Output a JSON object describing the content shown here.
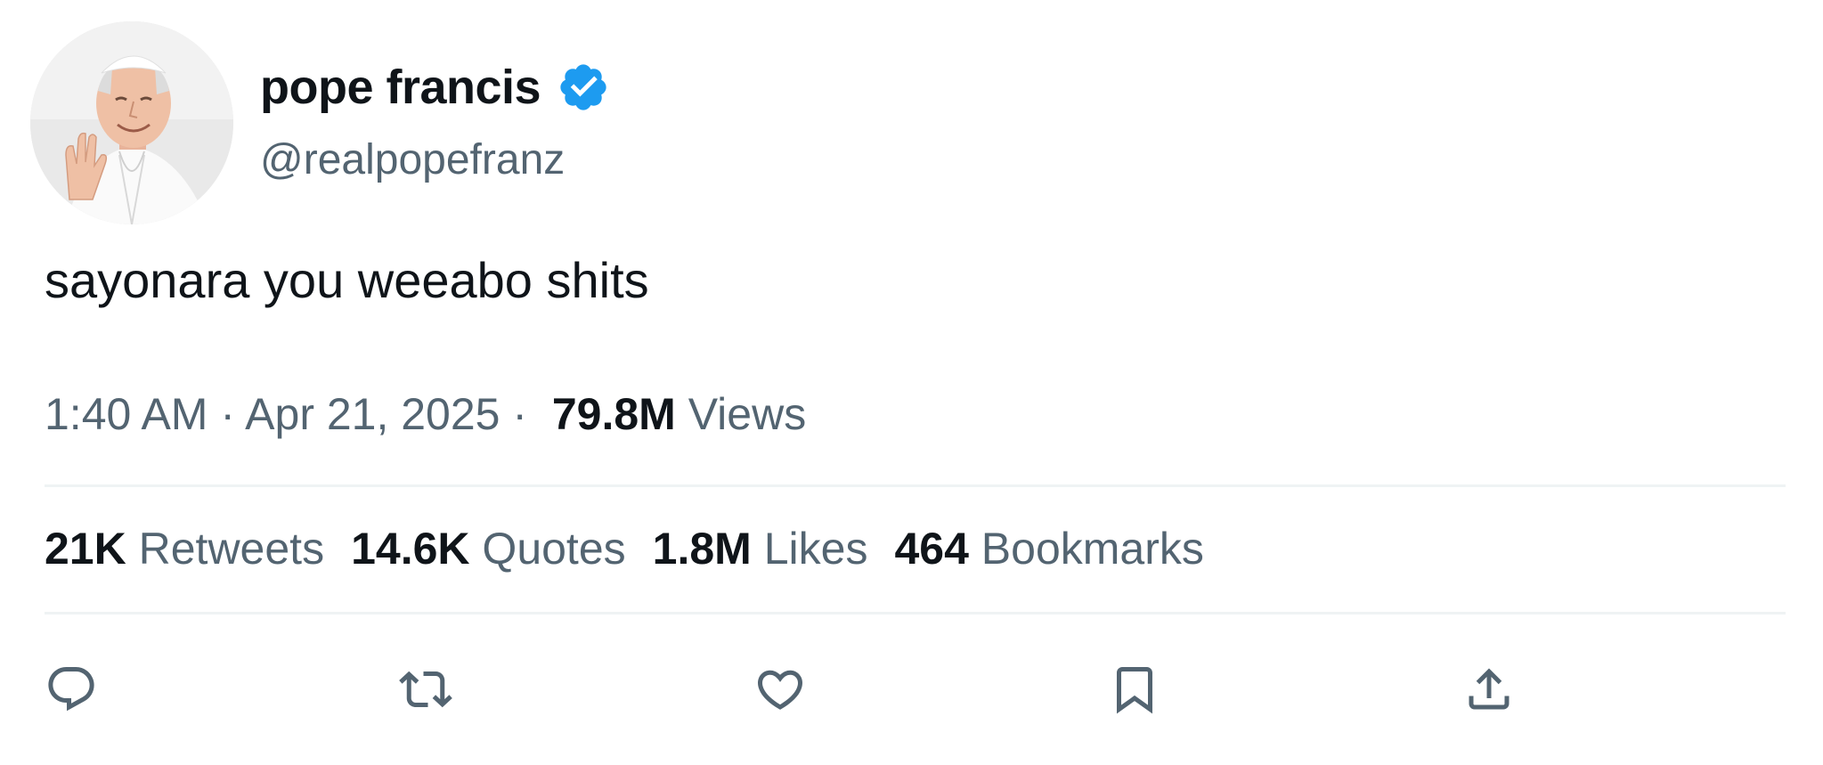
{
  "author": {
    "display_name": "pope francis",
    "handle": "@realpopefranz",
    "verified": true,
    "verified_icon": "verified-badge-icon",
    "verified_color": "#1d9bf0"
  },
  "tweet": {
    "text": "sayonara you weeabo shits"
  },
  "meta": {
    "time": "1:40 AM",
    "separator": "·",
    "date": "Apr 21, 2025",
    "views_count": "79.8M",
    "views_label": "Views"
  },
  "stats": [
    {
      "count": "21K",
      "label": "Retweets"
    },
    {
      "count": "14.6K",
      "label": "Quotes"
    },
    {
      "count": "1.8M",
      "label": "Likes"
    },
    {
      "count": "464",
      "label": "Bookmarks"
    }
  ],
  "actions": [
    {
      "name": "reply",
      "icon": "reply-icon"
    },
    {
      "name": "retweet",
      "icon": "retweet-icon"
    },
    {
      "name": "like",
      "icon": "heart-icon"
    },
    {
      "name": "bookmark",
      "icon": "bookmark-icon"
    },
    {
      "name": "share",
      "icon": "share-icon"
    }
  ],
  "colors": {
    "text_primary": "#0f1419",
    "text_secondary": "#536471",
    "divider": "#eff3f4",
    "accent": "#1d9bf0"
  }
}
